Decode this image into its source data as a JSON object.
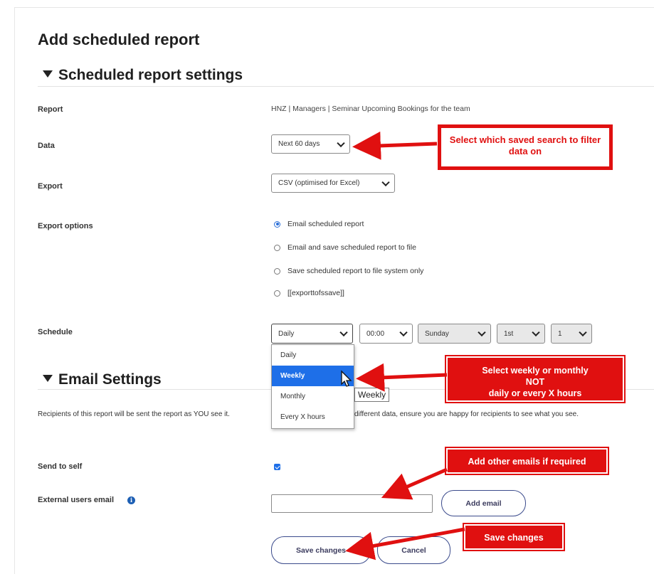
{
  "page": {
    "title": "Add scheduled report"
  },
  "settings": {
    "section_title": "Scheduled report settings",
    "report_label": "Report",
    "report_value": "HNZ | Managers | Seminar Upcoming Bookings for the team",
    "data_label": "Data",
    "data_selected": "Next 60 days",
    "export_label": "Export",
    "export_selected": "CSV (optimised for Excel)",
    "export_options_label": "Export options",
    "export_options": [
      {
        "label": "Email scheduled report",
        "selected": true
      },
      {
        "label": "Email and save scheduled report to file",
        "selected": false
      },
      {
        "label": "Save scheduled report to file system only",
        "selected": false
      },
      {
        "label": "[[exporttofssave]]",
        "selected": false
      }
    ],
    "schedule_label": "Schedule",
    "schedule_frequency": "Daily",
    "schedule_time": "00:00",
    "schedule_day": "Sunday",
    "schedule_date": "1st",
    "schedule_hours": "1",
    "frequency_options": [
      "Daily",
      "Weekly",
      "Monthly",
      "Every X hours"
    ],
    "frequency_highlighted": "Weekly",
    "tooltip": "Weekly"
  },
  "email": {
    "section_title": "Email Settings",
    "description_left": "Recipients of this report will be sent the report as YOU see it.",
    "description_right": "different data, ensure you are happy for recipients to see what you see.",
    "send_to_self_label": "Send to self",
    "send_to_self_checked": true,
    "external_label": "External users email",
    "external_value": "",
    "add_email_button": "Add email"
  },
  "actions": {
    "save_button": "Save changes",
    "cancel_button": "Cancel"
  },
  "annotations": {
    "data_callout": "Select which saved search to filter data on",
    "schedule_callout_line1": "Select weekly or monthly",
    "schedule_callout_line2": "NOT",
    "schedule_callout_line3": "daily or every X hours",
    "email_callout": "Add other emails if required",
    "save_callout": "Save changes",
    "color": "#e01010"
  }
}
